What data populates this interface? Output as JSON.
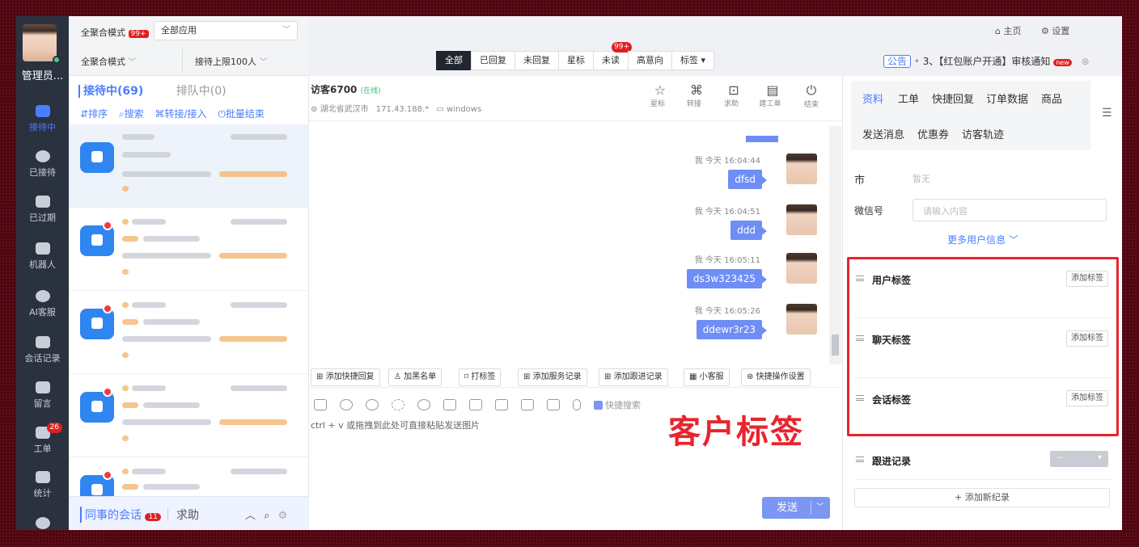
{
  "nav": {
    "admin_name": "管理员...",
    "items": [
      {
        "label": "接待中",
        "icon": "chat-icon"
      },
      {
        "label": "已接待",
        "icon": "check-circle-icon"
      },
      {
        "label": "已过期",
        "icon": "expired-icon"
      },
      {
        "label": "机器人",
        "icon": "robot-icon"
      },
      {
        "label": "AI客服",
        "icon": "ai-chat-icon"
      },
      {
        "label": "会话记录",
        "icon": "records-icon"
      },
      {
        "label": "留言",
        "icon": "message-icon"
      },
      {
        "label": "工单",
        "icon": "ticket-icon",
        "badge": "26"
      },
      {
        "label": "统计",
        "icon": "stats-icon"
      }
    ]
  },
  "topbar": {
    "mode_label": "全聚合模式",
    "mode_badge": "99+",
    "app_select": "全部应用",
    "mode_select": "全聚合模式",
    "limit_select": "接待上限100人",
    "home": "主页",
    "settings": "设置",
    "notice_tag": "公告",
    "notice_text": "3、【红包账户开通】审核通知",
    "notice_badge": "new"
  },
  "filter_tabs": [
    {
      "label": "全部",
      "active": true
    },
    {
      "label": "已回复"
    },
    {
      "label": "未回复"
    },
    {
      "label": "星标"
    },
    {
      "label": "未读",
      "badge": "99+"
    },
    {
      "label": "高意向"
    },
    {
      "label": "标签 ▾"
    }
  ],
  "session_list": {
    "tab_serving": "接待中(69)",
    "tab_queue": "排队中(0)",
    "actions": [
      "排序",
      "搜索",
      "转接/接入",
      "批量结束"
    ],
    "footer_tab": "同事的会话",
    "footer_badge": "11",
    "footer_help": "求助"
  },
  "chat": {
    "visitor": "访客6700",
    "status": "(在线)",
    "location": "湖北省武汉市",
    "ip": "171.43.188.*",
    "os": "windows",
    "header_actions": [
      {
        "label": "星标",
        "icon": "star-icon"
      },
      {
        "label": "转接",
        "icon": "transfer-icon"
      },
      {
        "label": "求助",
        "icon": "help-icon"
      },
      {
        "label": "建工单",
        "icon": "ticket-create-icon"
      },
      {
        "label": "结束",
        "icon": "power-icon"
      }
    ],
    "messages": [
      {
        "sender": "我",
        "time": "今天 16:04:44",
        "text": "dfsd"
      },
      {
        "sender": "我",
        "time": "今天 16:04:51",
        "text": "ddd"
      },
      {
        "sender": "我",
        "time": "今天 16:05:11",
        "text": "ds3w323425"
      },
      {
        "sender": "我",
        "time": "今天 16:05:26",
        "text": "ddewr3r23"
      }
    ],
    "quick_buttons": [
      "添加快捷回复",
      "加黑名单",
      "打标签",
      "添加服务记录",
      "添加跟进记录",
      "小客服",
      "快捷操作设置"
    ],
    "quick_search": "快捷搜索",
    "input_placeholder": "ctrl + v 或拖拽到此处可直接粘贴发送图片",
    "annotation": "客户标签",
    "send": "发送"
  },
  "right_panel": {
    "tabs_row1": [
      "资料",
      "工单",
      "快捷回复",
      "订单数据",
      "商品"
    ],
    "tabs_row2": [
      "发送消息",
      "优惠券",
      "访客轨迹"
    ],
    "city_label": "市",
    "city_value": "暂无",
    "wechat_label": "微信号",
    "wechat_placeholder": "请输入内容",
    "more_info": "更多用户信息",
    "sections": [
      {
        "title": "用户标签",
        "button": "添加标签"
      },
      {
        "title": "聊天标签",
        "button": "添加标签"
      },
      {
        "title": "会话标签",
        "button": "添加标签"
      }
    ],
    "followup_title": "跟进记录",
    "followup_select": "--",
    "add_record": "+ 添加新纪录"
  },
  "colors": {
    "accent": "#4a7dff",
    "bubble": "#6f8ef5",
    "annotation": "#e8242e",
    "nav_bg": "#2a313f"
  }
}
